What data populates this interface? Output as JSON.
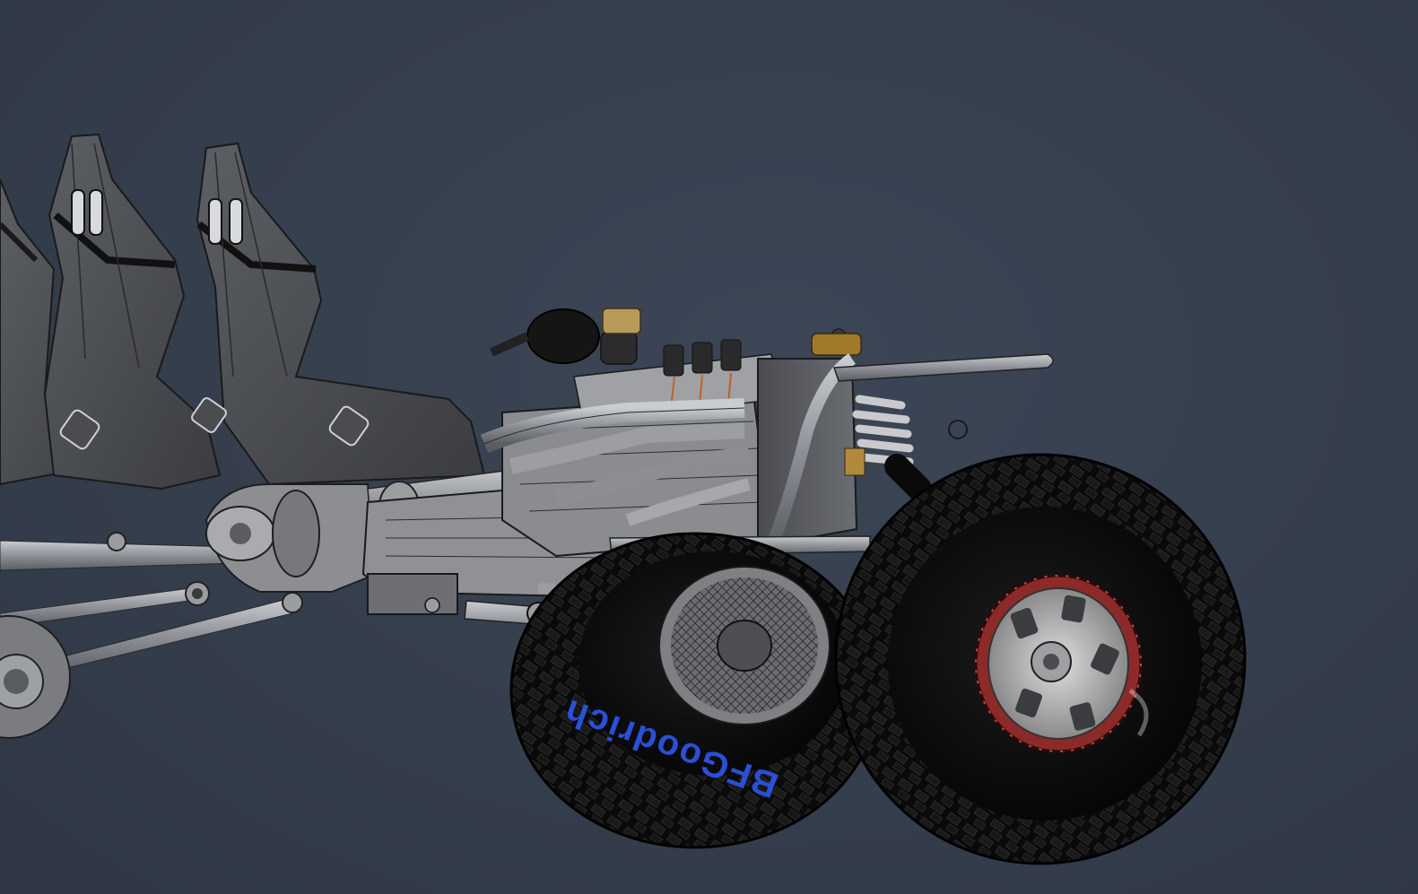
{
  "viewport": {
    "background": "#353e4c",
    "accent": "#2b4fd6"
  },
  "model": {
    "tire_brand_text": "BFGoodrich",
    "parts": [
      "bucket-seat",
      "bucket-seat",
      "bucket-seat",
      "engine-block",
      "exhaust-headers",
      "transmission",
      "front-fender",
      "coil-spring",
      "front-wheel",
      "rear-wheel",
      "trailing-arms",
      "driveshaft"
    ]
  }
}
